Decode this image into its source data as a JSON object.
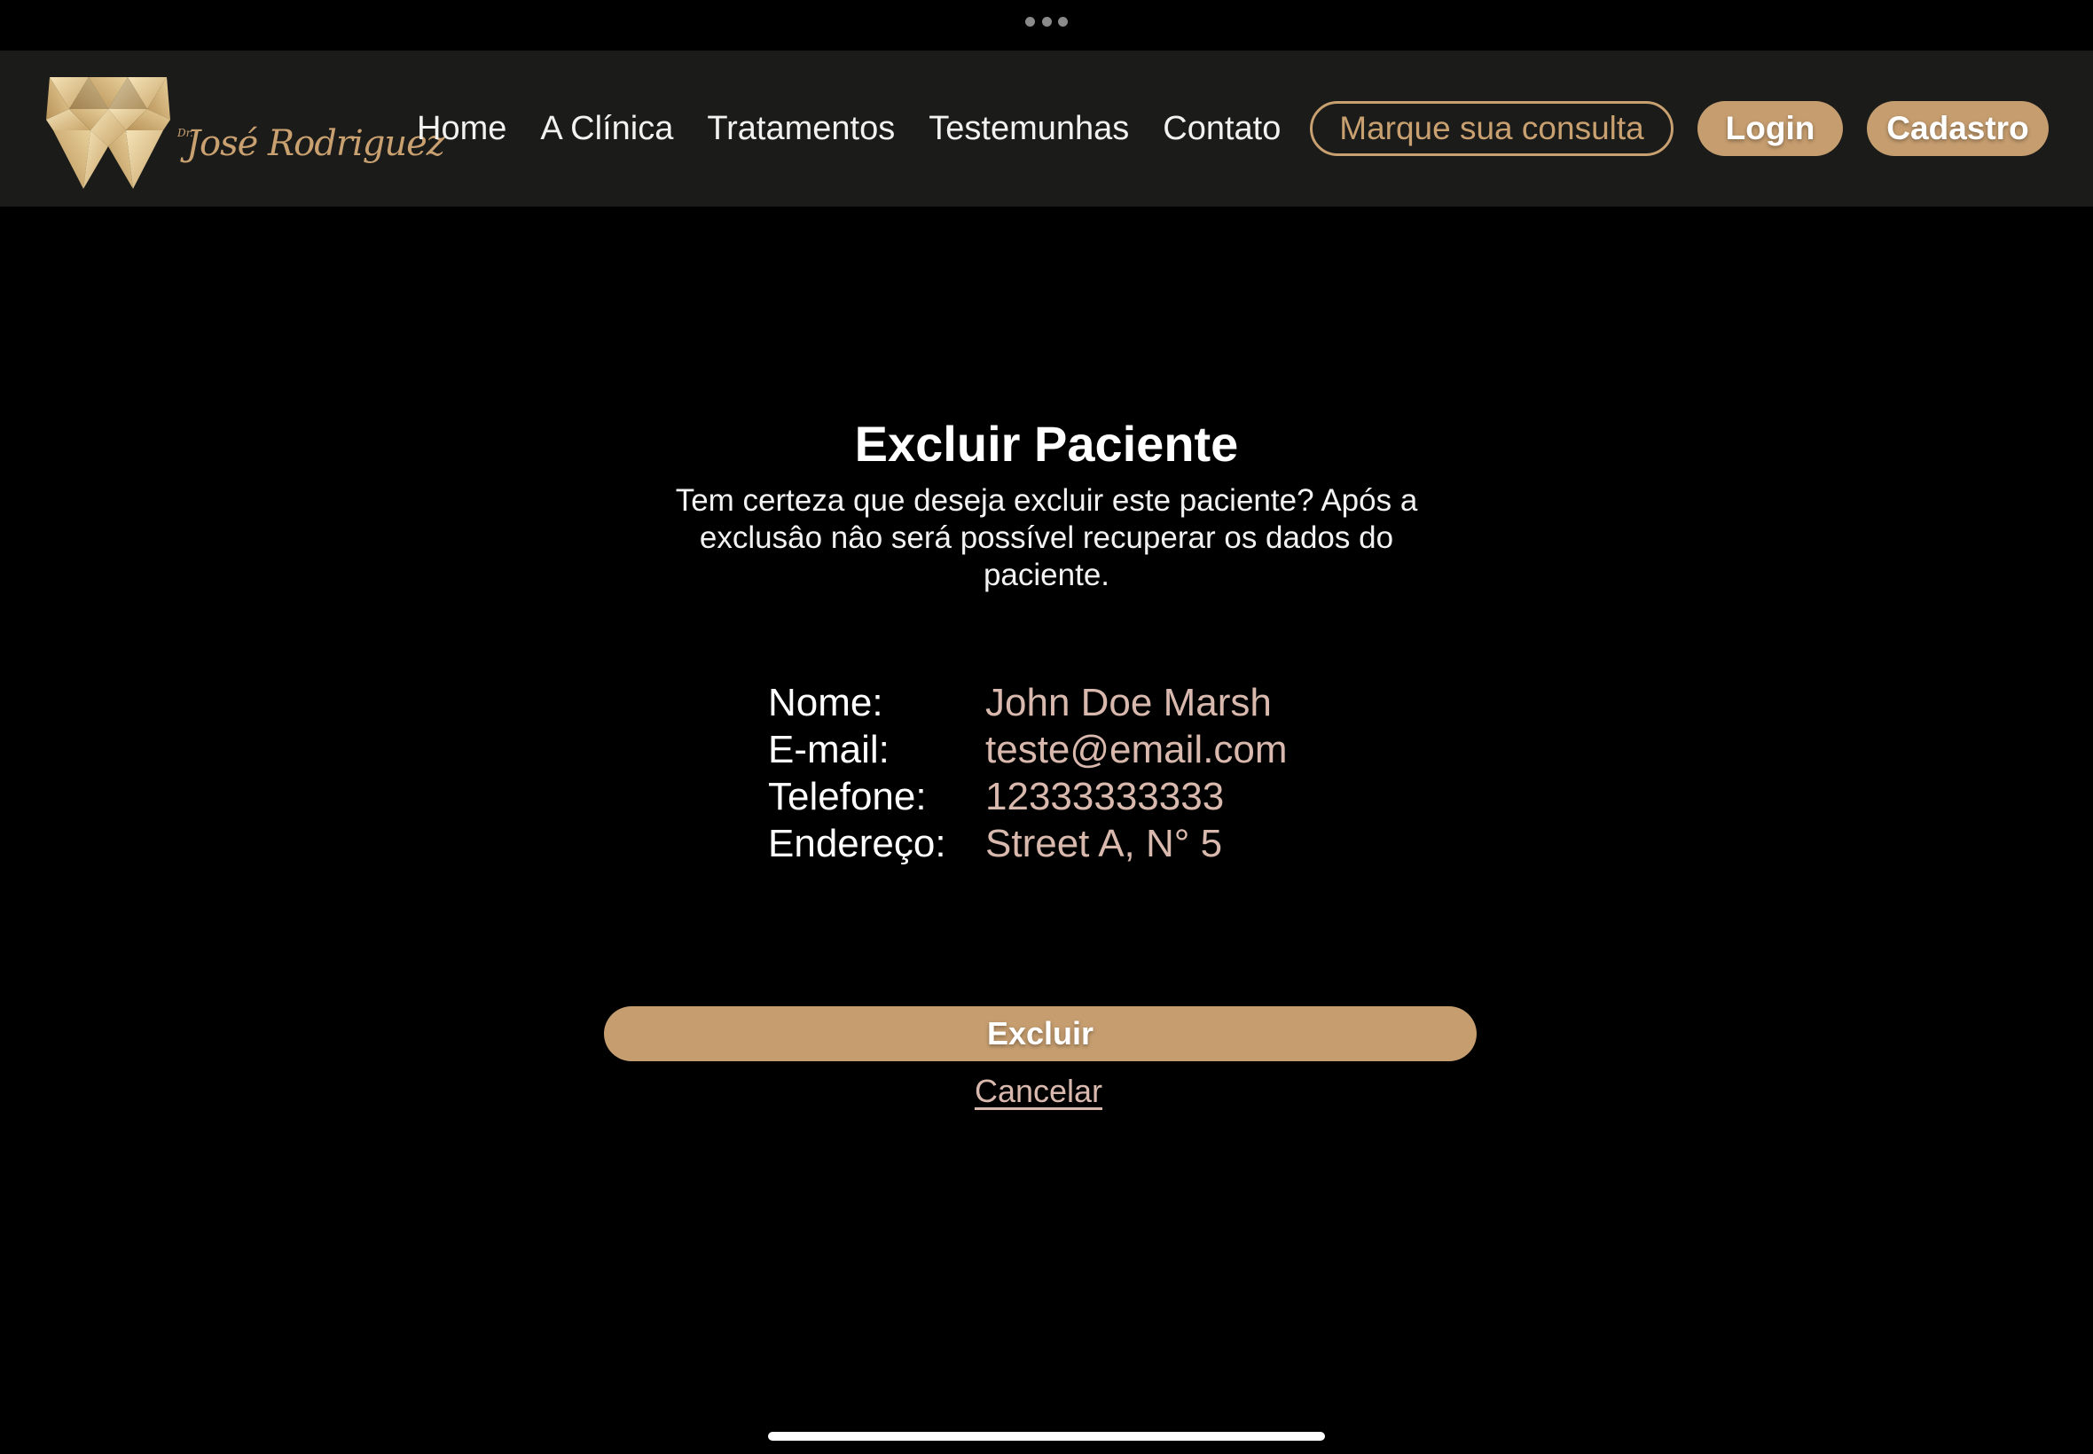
{
  "brand": {
    "prefix": "Dr.",
    "name": "José Rodriguez",
    "color_gold": "#c9a070"
  },
  "nav": {
    "links": [
      "Home",
      "A Clínica",
      "Tratamentos",
      "Testemunhas",
      "Contato"
    ],
    "cta_outline": "Marque sua consulta",
    "login": "Login",
    "signup": "Cadastro"
  },
  "dialog": {
    "title": "Excluir Paciente",
    "description": "Tem certeza que deseja excluir este paciente? Após a exclusâo nâo será possível recuperar os dados do paciente.",
    "fields": [
      {
        "label": "Nome:",
        "value": "John Doe Marsh"
      },
      {
        "label": "E-mail:",
        "value": "teste@email.com"
      },
      {
        "label": "Telefone:",
        "value": "12333333333"
      },
      {
        "label": "Endereço:",
        "value": "Street A, N° 5"
      }
    ],
    "confirm_label": "Excluir",
    "cancel_label": "Cancelar"
  },
  "colors": {
    "background": "#000000",
    "navbar": "#1b1b1a",
    "accent": "#c59d6f",
    "value_text": "#d9b9ad"
  }
}
